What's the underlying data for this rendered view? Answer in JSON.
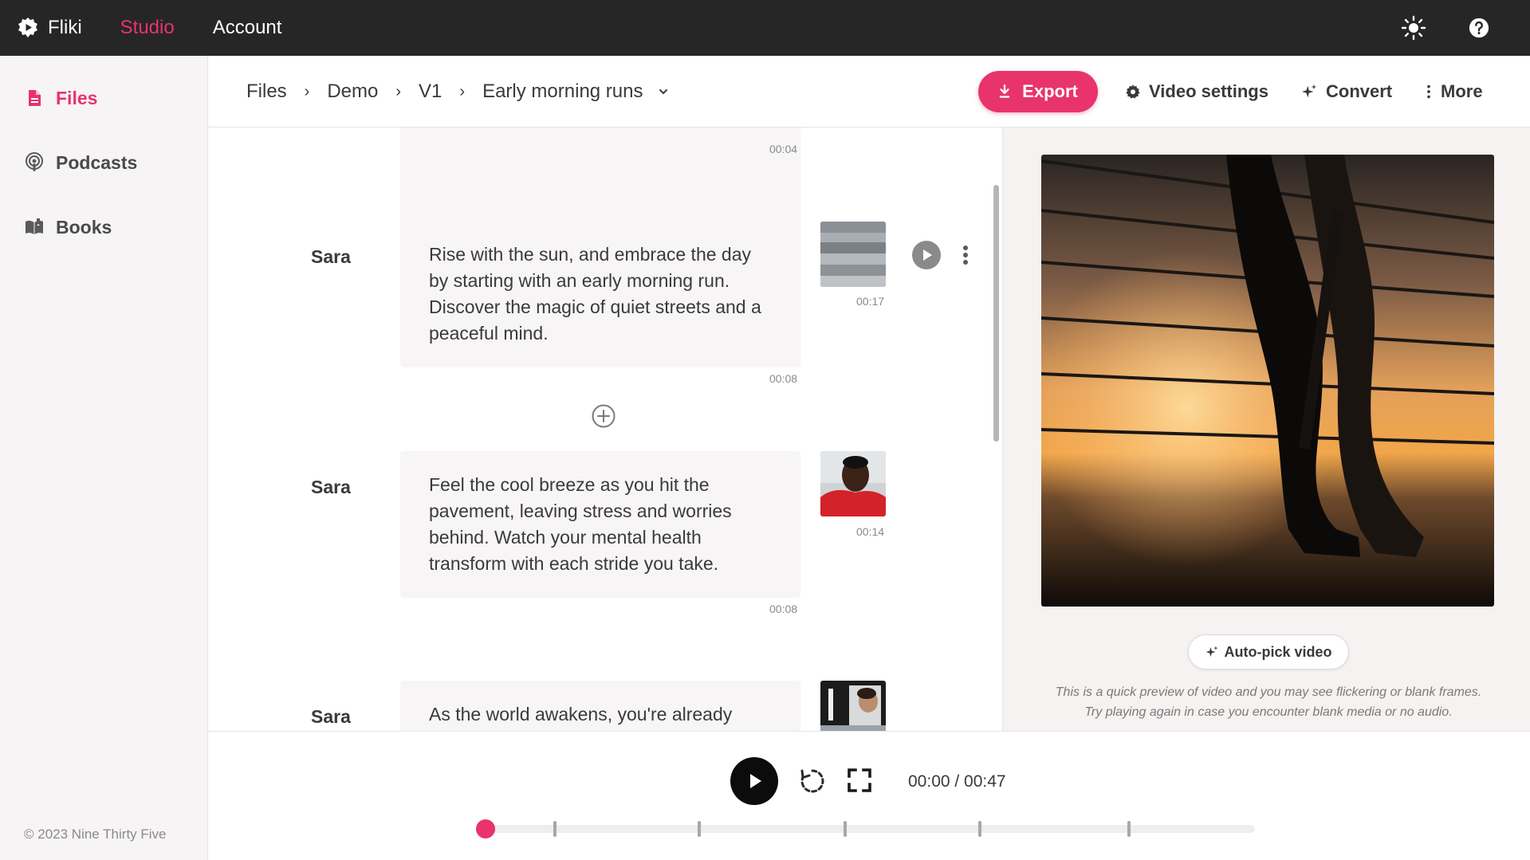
{
  "app": {
    "name": "Fliki",
    "nav": [
      "Studio",
      "Account"
    ],
    "active_nav": "Studio"
  },
  "icons": {
    "theme": "sun-icon",
    "help": "help-circle-icon"
  },
  "sidebar": {
    "items": [
      {
        "label": "Files",
        "icon": "file-icon",
        "active": true
      },
      {
        "label": "Podcasts",
        "icon": "podcast-icon",
        "active": false
      },
      {
        "label": "Books",
        "icon": "book-icon",
        "active": false
      }
    ],
    "copyright": "© 2023 Nine Thirty Five"
  },
  "breadcrumb": [
    "Files",
    "Demo",
    "V1",
    "Early morning runs"
  ],
  "toolbar": {
    "export": "Export",
    "video_settings": "Video settings",
    "convert": "Convert",
    "more": "More"
  },
  "scenes": {
    "first_duration": "00:04",
    "items": [
      {
        "speaker": "Sara",
        "text": "Rise with the sun, and embrace the day by starting with an early morning run. Discover the magic of quiet streets and a peaceful mind.",
        "media_duration": "00:17",
        "duration": "00:08"
      },
      {
        "speaker": "Sara",
        "text": "Feel the cool breeze as you hit the pavement, leaving stress and worries behind. Watch your mental health transform with each stride you take.",
        "media_duration": "00:14",
        "duration": "00:08"
      },
      {
        "speaker": "Sara",
        "text": "As the world awakens, you're already"
      }
    ]
  },
  "preview": {
    "autopick": "Auto-pick video",
    "note_line1": "This is a quick preview of video and you may see flickering or blank frames.",
    "note_line2": "Try playing again in case you encounter blank media or no audio."
  },
  "player": {
    "time": "00:00 / 00:47",
    "progress": 0
  },
  "colors": {
    "accent": "#e8336d",
    "topbar": "#262626",
    "sidebar_bg": "#f6f4f4",
    "scene_bg": "#f7f5f5"
  }
}
